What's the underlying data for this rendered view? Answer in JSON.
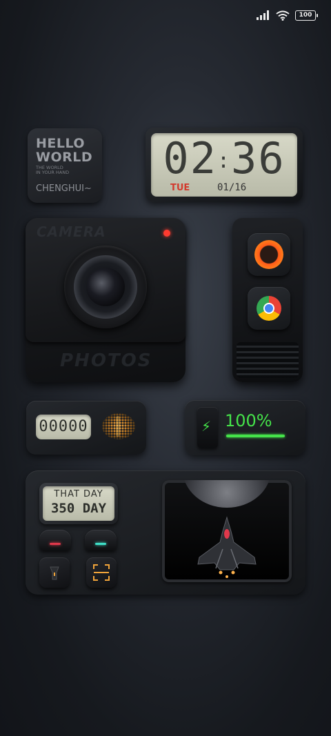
{
  "status_bar": {
    "signal_icon": "signal-bars-icon",
    "wifi_icon": "wifi-icon",
    "battery_level": "100"
  },
  "hello_widget": {
    "title_line1": "HELLO",
    "title_line2": "WORLD",
    "subtitle_line1": "THE WORLD",
    "subtitle_line2": "IN YOUR HAND",
    "author": "CHENGHUI~"
  },
  "clock_widget": {
    "hours": "02",
    "separator": ":",
    "minutes": "36",
    "day": "TUE",
    "date": "01/16",
    "day_color": "#d23b2e"
  },
  "camera_widget": {
    "top_label": "CAMERA",
    "bottom_label": "PHOTOS",
    "led_color": "#ff3b30"
  },
  "app_dock": {
    "apps": [
      {
        "name": "orange-ring-app-icon"
      },
      {
        "name": "chrome-icon"
      }
    ]
  },
  "counter_widget": {
    "value": "00000",
    "speaker_icon": "speaker-grille-icon"
  },
  "battery_widget": {
    "bolt": "⚡",
    "percent_text": "100%",
    "level": 1.0,
    "color": "#45e34a"
  },
  "bottom_widget": {
    "that_day_label": "THAT DAY",
    "day_count": "350 DAY",
    "buttons": [
      {
        "name": "red-indicator-button",
        "color": "#e0384b"
      },
      {
        "name": "teal-indicator-button",
        "color": "#3fe0c8"
      }
    ],
    "flashlight_icon": "flashlight-icon",
    "scan_icon": "scan-icon",
    "scan_color": "#f2a53a",
    "game_screen_icon": "spaceship-icon"
  }
}
